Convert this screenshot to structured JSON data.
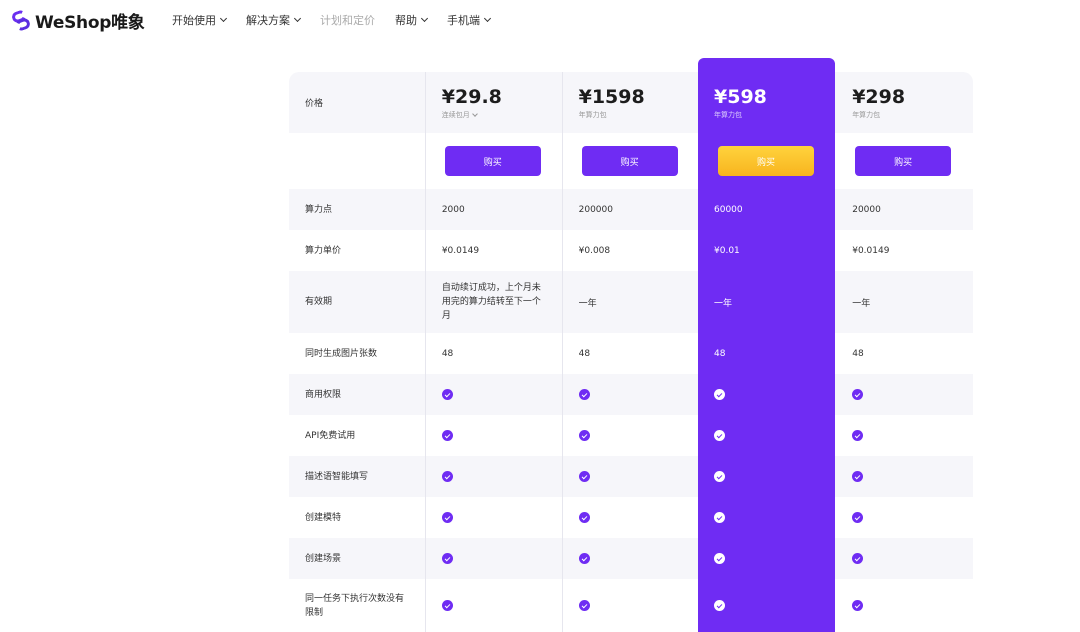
{
  "logo": {
    "text": "WeShop唯象"
  },
  "nav": [
    {
      "label": "开始使用",
      "dropdown": true
    },
    {
      "label": "解决方案",
      "dropdown": true
    },
    {
      "label": "计划和定价",
      "dropdown": false,
      "disabled": true
    },
    {
      "label": "帮助",
      "dropdown": true
    },
    {
      "label": "手机端",
      "dropdown": true
    }
  ],
  "table": {
    "price_label": "价格",
    "plans": [
      {
        "price": "¥29.8",
        "sub": "连续包月",
        "sub_dropdown": true,
        "button": "购买"
      },
      {
        "price": "¥1598",
        "sub": "年算力包",
        "button": "购买"
      },
      {
        "price": "¥598",
        "sub": "年算力包",
        "button": "购买"
      },
      {
        "price": "¥298",
        "sub": "年算力包",
        "button": "购买"
      }
    ],
    "rows": [
      {
        "label": "算力点",
        "values": [
          "2000",
          "200000",
          "60000",
          "20000"
        ]
      },
      {
        "label": "算力单价",
        "values": [
          "¥0.0149",
          "¥0.008",
          "¥0.01",
          "¥0.0149"
        ]
      },
      {
        "label": "有效期",
        "values": [
          "自动续订成功，上个月未用完的算力结转至下一个月",
          "一年",
          "一年",
          "一年"
        ]
      },
      {
        "label": "同时生成图片张数",
        "values": [
          "48",
          "48",
          "48",
          "48"
        ]
      },
      {
        "label": "商用权限",
        "check": true
      },
      {
        "label": "API免费试用",
        "check": true
      },
      {
        "label": "描述语智能填写",
        "check": true
      },
      {
        "label": "创建模特",
        "check": true
      },
      {
        "label": "创建场景",
        "check": true
      },
      {
        "label": "同一任务下执行次数没有限制",
        "check": true
      }
    ]
  },
  "colors": {
    "accent": "#6f2cf3",
    "gold": "#f8b41e",
    "shade": "#f6f6fa"
  }
}
